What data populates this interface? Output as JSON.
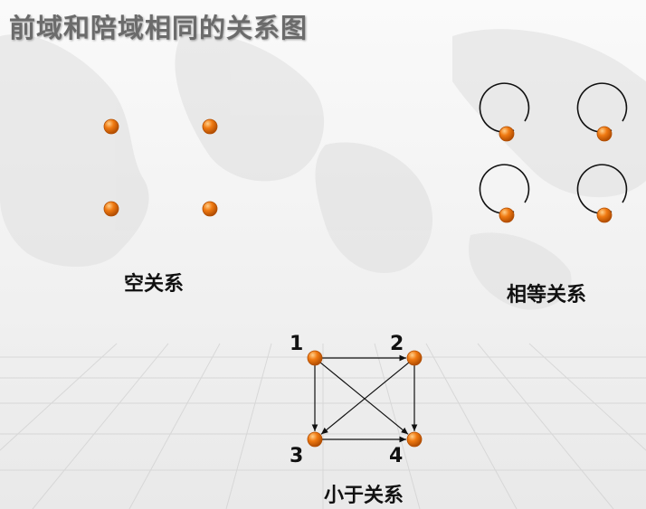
{
  "title": "前域和陪域相同的关系图",
  "colors": {
    "node": "#f07a12",
    "node_dark": "#b24e02",
    "edge": "#111111",
    "title": "#6b6b6b"
  },
  "panels": {
    "empty": {
      "caption": "空关系",
      "nodes": [
        {
          "id": "a1"
        },
        {
          "id": "a2"
        },
        {
          "id": "a3"
        },
        {
          "id": "a4"
        }
      ],
      "edges": []
    },
    "equality": {
      "caption": "相等关系",
      "nodes": [
        {
          "id": "b1"
        },
        {
          "id": "b2"
        },
        {
          "id": "b3"
        },
        {
          "id": "b4"
        }
      ],
      "edges": [
        {
          "from": "b1",
          "to": "b1"
        },
        {
          "from": "b2",
          "to": "b2"
        },
        {
          "from": "b3",
          "to": "b3"
        },
        {
          "from": "b4",
          "to": "b4"
        }
      ]
    },
    "less_than": {
      "caption": "小于关系",
      "nodes": [
        {
          "id": "1",
          "label": "1"
        },
        {
          "id": "2",
          "label": "2"
        },
        {
          "id": "3",
          "label": "3"
        },
        {
          "id": "4",
          "label": "4"
        }
      ],
      "edges": [
        {
          "from": "1",
          "to": "2"
        },
        {
          "from": "1",
          "to": "3"
        },
        {
          "from": "1",
          "to": "4"
        },
        {
          "from": "2",
          "to": "3"
        },
        {
          "from": "2",
          "to": "4"
        },
        {
          "from": "3",
          "to": "4"
        }
      ]
    }
  }
}
